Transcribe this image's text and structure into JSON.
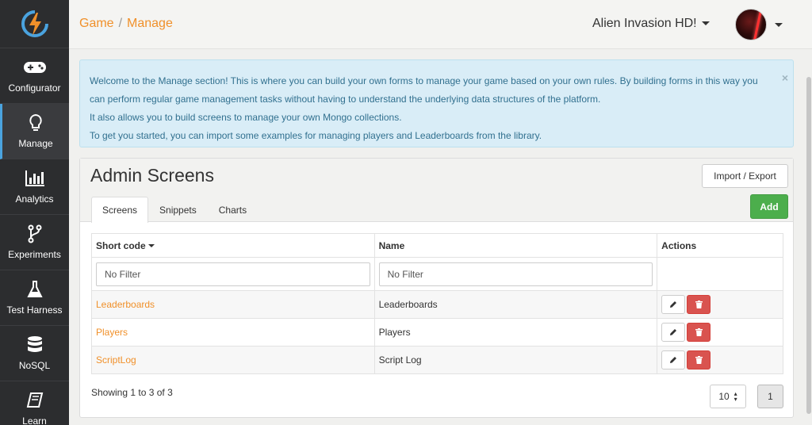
{
  "sidebar": {
    "items": [
      {
        "label": "Configurator",
        "icon": "gamepad-icon"
      },
      {
        "label": "Manage",
        "icon": "lightbulb-icon"
      },
      {
        "label": "Analytics",
        "icon": "bar-chart-icon"
      },
      {
        "label": "Experiments",
        "icon": "branch-icon"
      },
      {
        "label": "Test Harness",
        "icon": "flask-icon"
      },
      {
        "label": "NoSQL",
        "icon": "database-icon"
      },
      {
        "label": "Learn",
        "icon": "book-icon"
      }
    ],
    "active_index": 1
  },
  "header": {
    "breadcrumb": [
      "Game",
      "Manage"
    ],
    "breadcrumb_separator": "/",
    "game_name": "Alien Invasion HD!"
  },
  "alert": {
    "lines": [
      "Welcome to the Manage section! This is where you can build your own forms to manage your game based on your own rules. By building forms in this way you can perform regular game management tasks without having to understand the underlying data structures of the platform.",
      "It also allows you to build screens to manage your own Mongo collections.",
      "To get you started, you can import some examples for managing players and Leaderboards from the library."
    ],
    "close": "×"
  },
  "panel": {
    "title": "Admin Screens",
    "import_export_label": "Import / Export",
    "add_label": "Add",
    "tabs": [
      "Screens",
      "Snippets",
      "Charts"
    ],
    "active_tab": 0
  },
  "table": {
    "headers": [
      "Short code",
      "Name",
      "Actions"
    ],
    "filter_placeholders": [
      "No Filter",
      "No Filter"
    ],
    "rows": [
      {
        "short_code": "Leaderboards",
        "name": "Leaderboards"
      },
      {
        "short_code": "Players",
        "name": "Players"
      },
      {
        "short_code": "ScriptLog",
        "name": "Script Log"
      }
    ]
  },
  "footer": {
    "showing": "Showing 1 to 3 of 3",
    "page_size": "10",
    "current_page": "1"
  },
  "colors": {
    "accent": "#f0902a",
    "sidebar": "#2c2d2f",
    "success": "#4cae4c",
    "danger": "#d9534f",
    "info_bg": "#d9edf7"
  }
}
